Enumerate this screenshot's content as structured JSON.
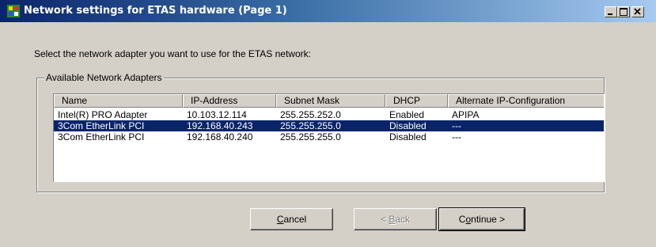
{
  "window": {
    "title": "Network settings for ETAS hardware (Page 1)",
    "controls": {
      "minimize_icon": "minimize-icon",
      "maximize_icon": "maximize-icon",
      "close_icon": "close-icon"
    }
  },
  "instruction": "Select the network adapter you want to use for the ETAS network:",
  "group": {
    "label": "Available Network Adapters",
    "columns": [
      "Name",
      "IP-Address",
      "Subnet Mask",
      "DHCP",
      "Alternate IP-Configuration"
    ],
    "rows": [
      {
        "name": "Intel(R) PRO Adapter",
        "ip": "10.103.12.114",
        "mask": "255.255.252.0",
        "dhcp": "Enabled",
        "alt": "APIPA",
        "selected": false
      },
      {
        "name": "3Com EtherLink PCI",
        "ip": "192.168.40.243",
        "mask": "255.255.255.0",
        "dhcp": "Disabled",
        "alt": "---",
        "selected": true
      },
      {
        "name": "3Com EtherLink PCI",
        "ip": "192.168.40.240",
        "mask": "255.255.255.0",
        "dhcp": "Disabled",
        "alt": "---",
        "selected": false
      }
    ]
  },
  "buttons": {
    "cancel": {
      "mnemonic": "C",
      "rest": "ancel"
    },
    "back": {
      "prefix": "< ",
      "mnemonic": "B",
      "rest": "ack",
      "enabled": false
    },
    "continue": {
      "prefix": "C",
      "mnemonic": "o",
      "rest": "ntinue >"
    }
  },
  "colors": {
    "title_gradient_start": "#0a246a",
    "title_gradient_end": "#a6caf0",
    "selection": "#0a246a",
    "dialog_face": "#d4d0c8"
  }
}
